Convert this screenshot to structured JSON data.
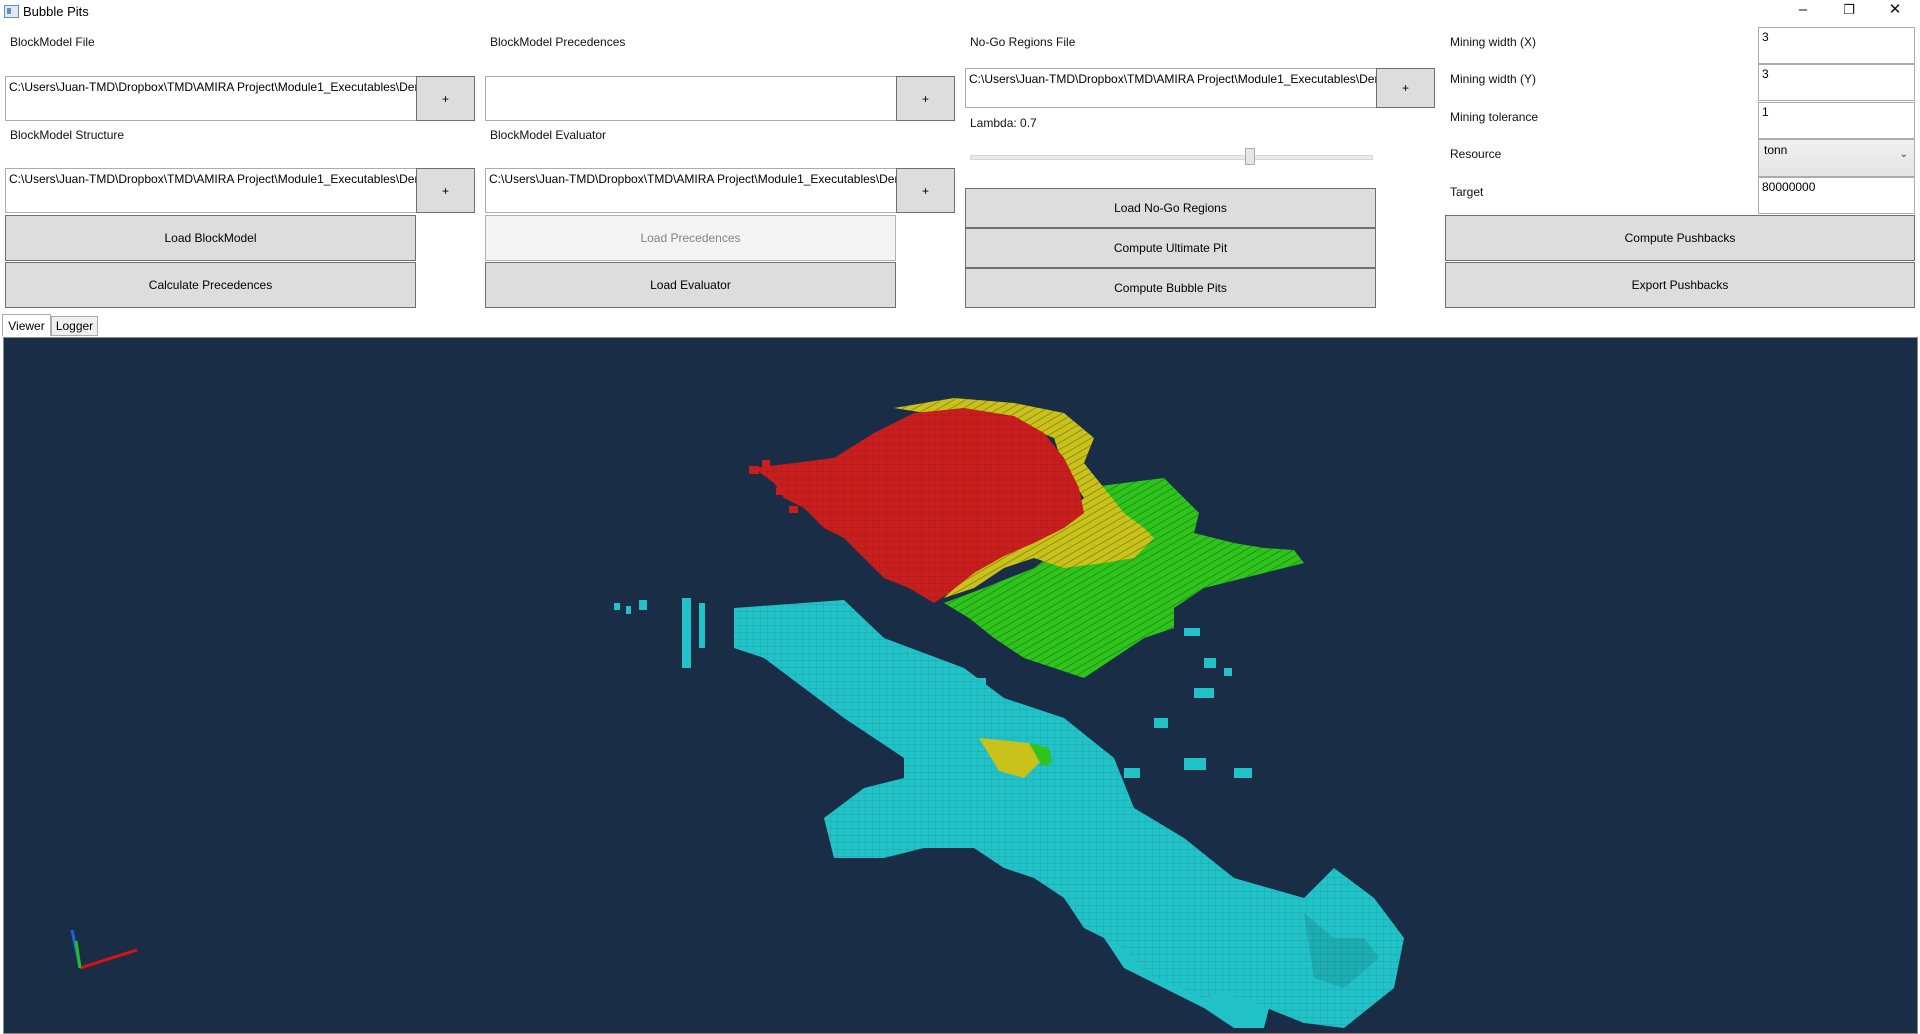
{
  "window": {
    "title": "Bubble Pits",
    "minimize": "–",
    "restore": "❐",
    "close": "✕"
  },
  "blockmodel": {
    "file_label": "BlockModel File",
    "file_value": "C:\\Users\\Juan-TMD\\Dropbox\\TMD\\AMIRA Project\\Module1_Executables\\Dem",
    "file_browse": "+",
    "structure_label": "BlockModel Structure",
    "structure_value": "C:\\Users\\Juan-TMD\\Dropbox\\TMD\\AMIRA Project\\Module1_Executables\\Dem",
    "structure_browse": "+",
    "load_button": "Load BlockModel",
    "calc_button": "Calculate Precedences"
  },
  "precedences": {
    "label": "BlockModel Precedences",
    "value": "",
    "browse": "+",
    "evaluator_label": "BlockModel Evaluator",
    "evaluator_value": "C:\\Users\\Juan-TMD\\Dropbox\\TMD\\AMIRA Project\\Module1_Executables\\Dem",
    "evaluator_browse": "+",
    "load_precedences_button": "Load Precedences",
    "load_evaluator_button": "Load Evaluator"
  },
  "nogo": {
    "label": "No-Go Regions File",
    "value": "C:\\Users\\Juan-TMD\\Dropbox\\TMD\\AMIRA Project\\Module1_Executables\\Dem",
    "browse": "+",
    "lambda_label": "Lambda: 0.7",
    "lambda_value": 0.7,
    "load_button": "Load No-Go Regions",
    "ultimate_button": "Compute Ultimate Pit",
    "bubble_button": "Compute Bubble Pits"
  },
  "params": {
    "mining_width_x_label": "Mining width (X)",
    "mining_width_x": "3",
    "mining_width_y_label": "Mining width (Y)",
    "mining_width_y": "3",
    "tolerance_label": "Mining tolerance",
    "tolerance": "1",
    "resource_label": "Resource",
    "resource": "tonn",
    "target_label": "Target",
    "target": "80000000",
    "compute_pushbacks": "Compute Pushbacks",
    "export_pushbacks": "Export Pushbacks"
  },
  "tabs": {
    "viewer": "Viewer",
    "logger": "Logger"
  },
  "viewer": {
    "background": "#1a2d47",
    "colors": {
      "pit1": "#c81e1e",
      "pit2": "#c9c21a",
      "pit3": "#2fc41c",
      "waste": "#21c3c8"
    }
  }
}
